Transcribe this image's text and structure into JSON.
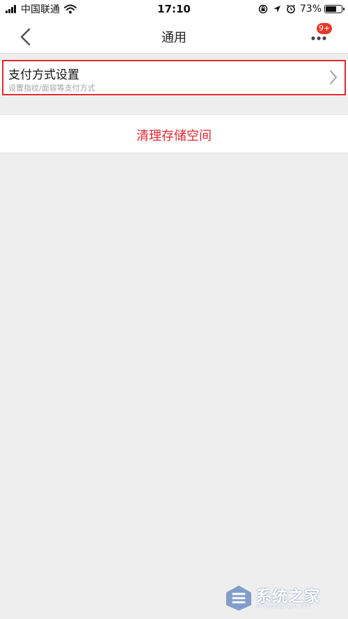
{
  "status_bar": {
    "carrier": "中国联通",
    "time": "17:10",
    "battery_percent": "73%",
    "battery_level": 0.73,
    "icons": [
      "signal-icon",
      "wifi-icon",
      "rotation-lock-icon",
      "location-icon",
      "alarm-icon",
      "battery-icon"
    ]
  },
  "nav": {
    "title": "通用",
    "back_icon": "chevron-left-icon",
    "more_icon": "more-dots-icon",
    "badge": "9+"
  },
  "payment_setting": {
    "title": "支付方式设置",
    "subtitle": "设置指纹/面容等支付方式",
    "chevron_icon": "chevron-right-icon"
  },
  "clear_storage": {
    "label": "清理存储空间"
  },
  "watermark": {
    "text": "系统之家",
    "subtext": "XITONGZHIJIA.NET"
  },
  "colors": {
    "accent_red": "#e3262d",
    "badge_red": "#e8392c",
    "background": "#eeeeee",
    "card": "#ffffff"
  }
}
